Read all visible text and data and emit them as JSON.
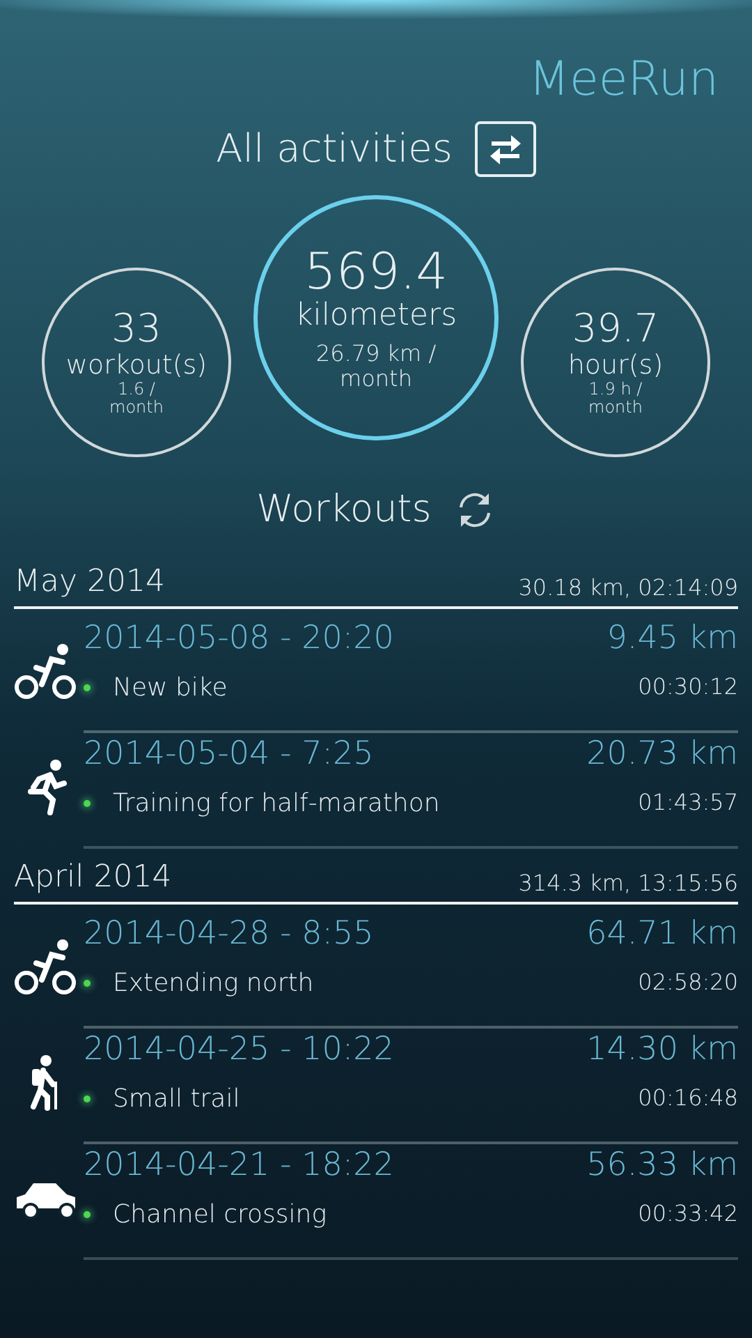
{
  "app_title": "MeeRun",
  "filter": {
    "label": "All activities"
  },
  "stats": [
    {
      "kind": "side",
      "value": "33",
      "unit": "workout(s)",
      "rate": "1.6 /\nmonth"
    },
    {
      "kind": "main",
      "value": "569.4",
      "unit": "kilometers",
      "rate": "26.79 km /\nmonth"
    },
    {
      "kind": "side",
      "value": "39.7",
      "unit": "hour(s)",
      "rate": "1.9 h /\nmonth"
    }
  ],
  "workouts_title": "Workouts",
  "sections": [
    {
      "month": "May 2014",
      "summary": "30.18 km, 02:14:09",
      "workouts": [
        {
          "kind": "bike",
          "date": "2014-05-08 - 20:20",
          "distance": "9.45 km",
          "name": "New bike",
          "duration": "00:30:12"
        },
        {
          "kind": "run",
          "date": "2014-05-04 - 7:25",
          "distance": "20.73 km",
          "name": "Training for half-marathon",
          "duration": "01:43:57"
        }
      ]
    },
    {
      "month": "April 2014",
      "summary": "314.3 km, 13:15:56",
      "workouts": [
        {
          "kind": "bike",
          "date": "2014-04-28 - 8:55",
          "distance": "64.71 km",
          "name": "Extending north",
          "duration": "02:58:20"
        },
        {
          "kind": "hike",
          "date": "2014-04-25 - 10:22",
          "distance": "14.30 km",
          "name": "Small trail",
          "duration": "00:16:48"
        },
        {
          "kind": "car",
          "date": "2014-04-21 - 18:22",
          "distance": "56.33 km",
          "name": "Channel crossing",
          "duration": "00:33:42"
        }
      ]
    }
  ]
}
